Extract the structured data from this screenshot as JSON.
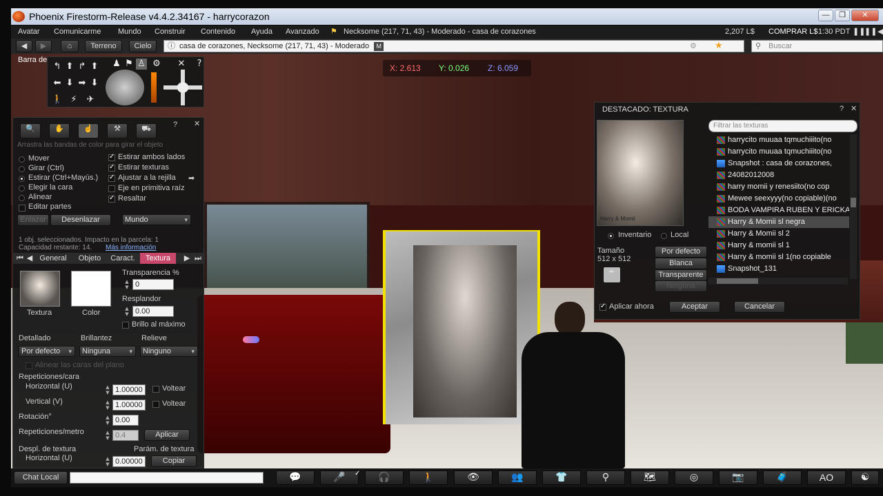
{
  "window": {
    "title": "Phoenix Firestorm-Release v4.4.2.34167 - harrycorazon",
    "buttons": [
      "—",
      "❐",
      "✕"
    ]
  },
  "menu": {
    "items": [
      "Avatar",
      "Comunicarme",
      "Mundo",
      "Construir",
      "Contenido",
      "Ayuda",
      "Avanzado"
    ],
    "status": "Necksome (217, 71, 43) - Moderado - casa de corazones",
    "balance": "2,207 L$",
    "buy": "COMPRAR L$",
    "time": "1:30 PDT"
  },
  "nav": {
    "terreno": "Terreno",
    "cielo": "Cielo",
    "location": "casa de corazones, Necksome (217, 71, 43) - Moderado",
    "location_badge": "M",
    "search_placeholder": "Buscar"
  },
  "hud": {
    "barra_label": "Barra de",
    "x": "X: 2.613",
    "y": "Y: 0.026",
    "z": "Z: 6.059"
  },
  "build": {
    "hint": "Arrastra las bandas de color para girar el objeto",
    "modes": [
      "Mover",
      "Girar (Ctrl)",
      "Estirar (Ctrl+Mayús.)",
      "Elegir la cara",
      "Alinear",
      "Editar partes"
    ],
    "options": [
      "Estirar ambos lados",
      "Estirar texturas",
      "Ajustar a la rejilla",
      "Eje en primitiva raíz",
      "Resaltar"
    ],
    "enlazar": "Enlazar",
    "desenlazar": "Desenlazar",
    "grid_mode": "Mundo",
    "info1": "1 obj. seleccionados. Impacto en la parcela: 1",
    "info2": "Capacidad restante: 14.",
    "more_info": "Más información",
    "tabs": [
      "General",
      "Objeto",
      "Caract.",
      "Textura"
    ],
    "textura_label": "Textura",
    "color_label": "Color",
    "transparencia_label": "Transparencia %",
    "transparencia_value": "0",
    "resplandor_label": "Resplandor",
    "resplandor_value": "0.00",
    "brillo_max": "Brillo al máximo",
    "detallado_label": "Detallado",
    "detallado_value": "Por defecto",
    "brillantez_label": "Brillantez",
    "brillantez_value": "Ninguna",
    "relieve_label": "Relieve",
    "relieve_value": "Ninguno",
    "alinear_caras": "Alinear las caras del plano",
    "repeticiones_label": "Repeticiones/cara",
    "horizontal_label": "Horizontal (U)",
    "horizontal_value": "1.00000",
    "vertical_label": "Vertical (V)",
    "vertical_value": "1.00000",
    "voltear": "Voltear",
    "rotacion_label": "Rotación°",
    "rotacion_value": "0.00",
    "rep_metro_label": "Repeticiones/metro",
    "rep_metro_value": "0.4",
    "aplicar": "Aplicar",
    "despl_label": "Despl. de textura",
    "param_label": "Parám. de textura",
    "despl_h_label": "Horizontal (U)",
    "despl_h_value": "0.00000",
    "copiar": "Copiar"
  },
  "texture_picker": {
    "title": "DESTACADO: TEXTURA",
    "filter_placeholder": "Filtrar las texturas",
    "preview_caption": "Harry & Momii",
    "source_inventario": "Inventario",
    "source_local": "Local",
    "size_label": "Tamaño",
    "size_value": "512 x 512",
    "btn_default": "Por defecto",
    "btn_blank": "Blanca",
    "btn_transparent": "Transparente",
    "btn_none": "Ninguna",
    "apply_now": "Aplicar ahora",
    "accept": "Aceptar",
    "cancel": "Cancelar",
    "items": [
      {
        "label": "harrycito muuaa tqmuchiiito(no",
        "icon": "texture-icon"
      },
      {
        "label": "harrycito muuaa tqmuchiiito(no",
        "icon": "texture-icon"
      },
      {
        "label": "Snapshot : casa de corazones,",
        "icon": "snapshot-icon"
      },
      {
        "label": "24082012008",
        "icon": "texture-icon"
      },
      {
        "label": "harry momii y renesiito(no cop",
        "icon": "texture-icon"
      },
      {
        "label": "Mewee seexyyy(no copiable)(no",
        "icon": "texture-icon"
      },
      {
        "label": "BODA VAMPIRA RUBEN Y ERICKA",
        "icon": "texture-icon"
      },
      {
        "label": "Harry & Momii sl negra",
        "icon": "texture-icon"
      },
      {
        "label": "Harry & Momii sl 2",
        "icon": "texture-icon"
      },
      {
        "label": "Harry & momii sl 1",
        "icon": "texture-icon"
      },
      {
        "label": "Harry & momii sl 1(no copiable",
        "icon": "texture-icon"
      },
      {
        "label": "Snapshot_131",
        "icon": "snapshot-icon"
      }
    ]
  },
  "bottom": {
    "chat_label": "Chat Local",
    "ao_label": "AO"
  }
}
